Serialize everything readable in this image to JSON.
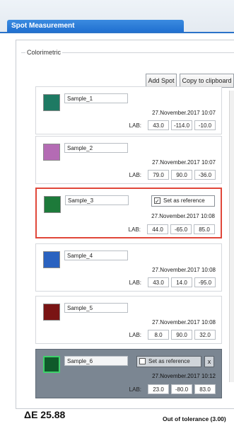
{
  "app": {
    "tab_title": "Spot Measurement"
  },
  "group": {
    "label": "Colorimetric"
  },
  "toolbar": {
    "add_spot": "Add Spot",
    "copy_clipboard": "Copy to clipboard"
  },
  "cards": [
    {
      "name": "Sample_1",
      "swatch": "#1e7a63",
      "timestamp": "27.November.2017 10:07",
      "lab_label": "LAB:",
      "lab": [
        "43.0",
        "-114.0",
        "-10.0"
      ]
    },
    {
      "name": "Sample_2",
      "swatch": "#b46bb4",
      "timestamp": "27.November.2017 10:07",
      "lab_label": "LAB:",
      "lab": [
        "79.0",
        "90.0",
        "-36.0"
      ]
    },
    {
      "name": "Sample_3",
      "swatch": "#1d7a3a",
      "reference_label": "Set as reference",
      "reference_checked": true,
      "timestamp": "27.November.2017 10:08",
      "lab_label": "LAB:",
      "lab": [
        "44.0",
        "-65.0",
        "85.0"
      ]
    },
    {
      "name": "Sample_4",
      "swatch": "#2a62c0",
      "timestamp": "27.November.2017 10:08",
      "lab_label": "LAB:",
      "lab": [
        "43.0",
        "14.0",
        "-95.0"
      ]
    },
    {
      "name": "Sample_5",
      "swatch": "#7a1414",
      "timestamp": "27.November.2017 10:08",
      "lab_label": "LAB:",
      "lab": [
        "8.0",
        "90.0",
        "32.0"
      ]
    },
    {
      "name": "Sample_6",
      "swatch": "#0f5a2a",
      "reference_label": "Set as reference",
      "reference_checked": false,
      "close_label": "x",
      "timestamp": "27.November.2017 10:12",
      "lab_label": "LAB:",
      "lab": [
        "23.0",
        "-80.0",
        "83.0"
      ]
    }
  ],
  "footer": {
    "delta_e": "ΔE 25.88",
    "tolerance": "Out of tolerance (3.00)"
  },
  "colors": {
    "accent": "#1f6fd0",
    "selected_border": "#e0473a",
    "dark_card": "#7b8692",
    "dark_swatch_border": "#3fd06b"
  }
}
